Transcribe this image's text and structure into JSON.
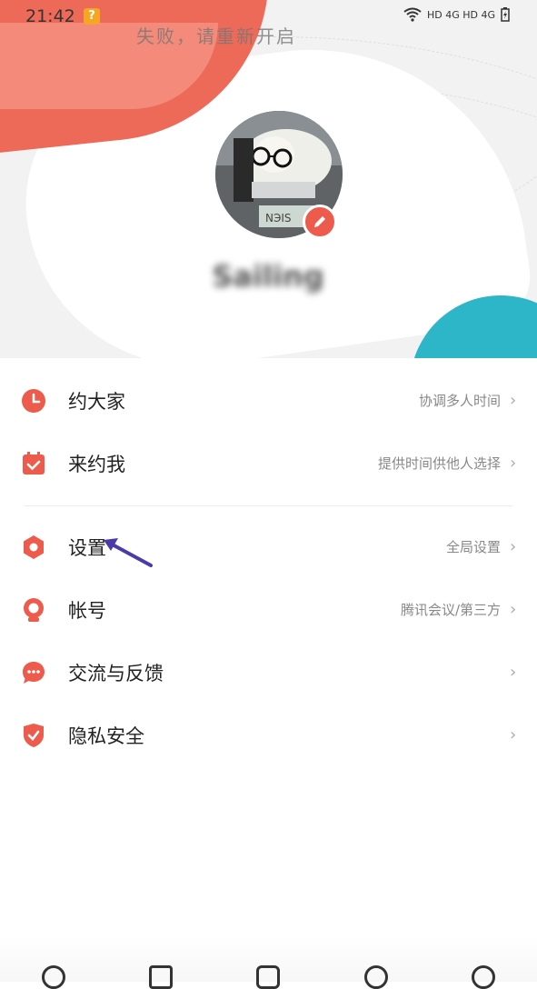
{
  "status_bar": {
    "time": "21:42",
    "signal_text": "HD 4G HD 4G"
  },
  "banner": {
    "text": "失败，请重新开启"
  },
  "profile": {
    "username": "Sailing"
  },
  "menu": {
    "items": [
      {
        "label": "约大家",
        "sub": "协调多人时间",
        "icon": "clock-icon",
        "color": "#ec5b4b"
      },
      {
        "label": "来约我",
        "sub": "提供时间供他人选择",
        "icon": "calendar-check-icon",
        "color": "#ec5b4b"
      },
      {
        "label": "设置",
        "sub": "全局设置",
        "icon": "settings-icon",
        "color": "#ec5b4b"
      },
      {
        "label": "帐号",
        "sub": "腾讯会议/第三方",
        "icon": "account-icon",
        "color": "#ec5b4b"
      },
      {
        "label": "交流与反馈",
        "sub": "",
        "icon": "chat-icon",
        "color": "#ec5b4b"
      },
      {
        "label": "隐私安全",
        "sub": "",
        "icon": "shield-icon",
        "color": "#ec5b4b"
      }
    ]
  },
  "colors": {
    "accent": "#ec5b4b",
    "teal": "#2cb6c8",
    "annotation": "#4b3aa8"
  }
}
